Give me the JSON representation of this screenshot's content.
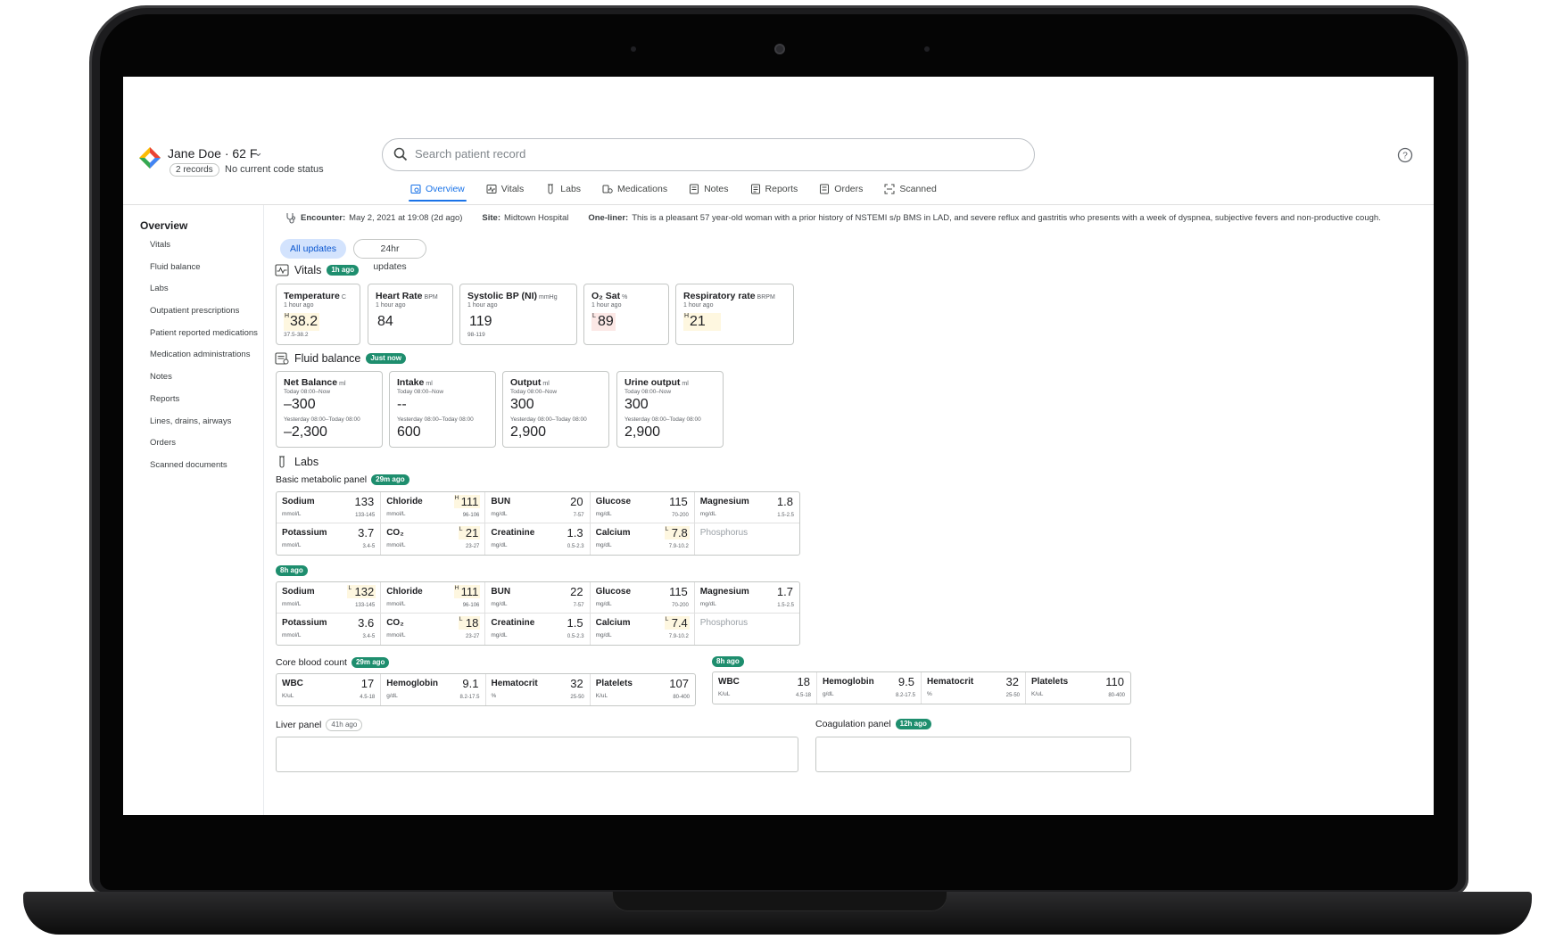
{
  "header": {
    "patient_name": "Jane Doe · 62 F",
    "records_chip": "2 records",
    "code_status": "No current code status",
    "search_placeholder": "Search patient record"
  },
  "tabs": [
    "Overview",
    "Vitals",
    "Labs",
    "Medications",
    "Notes",
    "Reports",
    "Orders",
    "Scanned"
  ],
  "sidebar": {
    "title": "Overview",
    "items": [
      "Vitals",
      "Fluid balance",
      "Labs",
      "Outpatient prescriptions",
      "Patient reported medications",
      "Medication administrations",
      "Notes",
      "Reports",
      "Lines, drains, airways",
      "Orders",
      "Scanned documents"
    ]
  },
  "encounter": {
    "encounter_label": "Encounter:",
    "encounter_value": "May 2, 2021 at 19:08 (2d ago)",
    "site_label": "Site:",
    "site_value": "Midtown Hospital",
    "oneliner_label": "One-liner:",
    "oneliner_value": "This is a pleasant 57 year-old woman with a prior history of NSTEMI s/p BMS in LAD, and severe reflux and gastritis who presents with a week of dyspnea, subjective fevers and non-productive cough."
  },
  "filters": {
    "all": "All updates",
    "day": "24hr updates"
  },
  "vitals": {
    "title": "Vitals",
    "badge": "1h ago",
    "cards": [
      {
        "name": "Temperature",
        "unit": "C",
        "time": "1 hour ago",
        "flag": "H",
        "value": "38.2",
        "range": "37.5-38.2",
        "state": "hl"
      },
      {
        "name": "Heart Rate",
        "unit": "BPM",
        "time": "1 hour ago",
        "flag": "",
        "value": "84",
        "range": "",
        "state": ""
      },
      {
        "name": "Systolic BP (NI)",
        "unit": "mmHg",
        "time": "1 hour ago",
        "flag": "",
        "value": "119",
        "range": "98-119",
        "state": ""
      },
      {
        "name": "O₂ Sat",
        "unit": "%",
        "time": "1 hour ago",
        "flag": "L",
        "value": "89",
        "range": "",
        "state": "lo"
      },
      {
        "name": "Respiratory rate",
        "unit": "BRPM",
        "time": "1 hour ago",
        "flag": "H",
        "value": "21",
        "range": "",
        "state": "hl"
      }
    ]
  },
  "fluid": {
    "title": "Fluid balance",
    "badge": "Just now",
    "cards": [
      {
        "name": "Net Balance",
        "unit": "ml",
        "time1": "Today 08:00–Now",
        "value1": "–300",
        "time2": "Yesterday 08:00–Today 08:00",
        "value2": "–2,300"
      },
      {
        "name": "Intake",
        "unit": "ml",
        "time1": "Today 08:00–Now",
        "value1": "--",
        "time2": "Yesterday 08:00–Today 08:00",
        "value2": "600"
      },
      {
        "name": "Output",
        "unit": "ml",
        "time1": "Today 08:00–Now",
        "value1": "300",
        "time2": "Yesterday 08:00–Today 08:00",
        "value2": "2,900"
      },
      {
        "name": "Urine output",
        "unit": "ml",
        "time1": "Today 08:00–Now",
        "value1": "300",
        "time2": "Yesterday 08:00–Today 08:00",
        "value2": "2,900"
      }
    ]
  },
  "labs": {
    "title": "Labs",
    "bmp_title": "Basic metabolic panel",
    "bmp_badge": "29m ago",
    "bmp": [
      {
        "name": "Sodium",
        "unit": "mmol/L",
        "value": "133",
        "range": "133-145",
        "flag": ""
      },
      {
        "name": "Chloride",
        "unit": "mmol/L",
        "value": "111",
        "range": "96-106",
        "flag": "H"
      },
      {
        "name": "BUN",
        "unit": "mg/dL",
        "value": "20",
        "range": "7-57",
        "flag": ""
      },
      {
        "name": "Glucose",
        "unit": "mg/dL",
        "value": "115",
        "range": "70-200",
        "flag": ""
      },
      {
        "name": "Magnesium",
        "unit": "mg/dL",
        "value": "1.8",
        "range": "1.5-2.5",
        "flag": ""
      },
      {
        "name": "Potassium",
        "unit": "mmol/L",
        "value": "3.7",
        "range": "3.4-5",
        "flag": ""
      },
      {
        "name": "CO₂",
        "unit": "mmol/L",
        "value": "21",
        "range": "23-27",
        "flag": "L"
      },
      {
        "name": "Creatinine",
        "unit": "mg/dL",
        "value": "1.3",
        "range": "0.5-2.3",
        "flag": ""
      },
      {
        "name": "Calcium",
        "unit": "mg/dL",
        "value": "7.8",
        "range": "7.9-10.2",
        "flag": "L"
      },
      {
        "name": "Phosphorus",
        "unit": "",
        "value": "",
        "range": "",
        "flag": ""
      }
    ],
    "bmp2_badge": "8h ago",
    "bmp2": [
      {
        "name": "Sodium",
        "unit": "mmol/L",
        "value": "132",
        "range": "133-145",
        "flag": "L"
      },
      {
        "name": "Chloride",
        "unit": "mmol/L",
        "value": "111",
        "range": "96-106",
        "flag": "H"
      },
      {
        "name": "BUN",
        "unit": "mg/dL",
        "value": "22",
        "range": "7-57",
        "flag": ""
      },
      {
        "name": "Glucose",
        "unit": "mg/dL",
        "value": "115",
        "range": "70-200",
        "flag": ""
      },
      {
        "name": "Magnesium",
        "unit": "mg/dL",
        "value": "1.7",
        "range": "1.5-2.5",
        "flag": ""
      },
      {
        "name": "Potassium",
        "unit": "mmol/L",
        "value": "3.6",
        "range": "3.4-5",
        "flag": ""
      },
      {
        "name": "CO₂",
        "unit": "mmol/L",
        "value": "18",
        "range": "23-27",
        "flag": "L"
      },
      {
        "name": "Creatinine",
        "unit": "mg/dL",
        "value": "1.5",
        "range": "0.5-2.3",
        "flag": ""
      },
      {
        "name": "Calcium",
        "unit": "mg/dL",
        "value": "7.4",
        "range": "7.9-10.2",
        "flag": "L"
      },
      {
        "name": "Phosphorus",
        "unit": "",
        "value": "",
        "range": "",
        "flag": ""
      }
    ],
    "cbc_title": "Core blood count",
    "cbc_badge": "29m ago",
    "cbc": [
      {
        "name": "WBC",
        "unit": "K/uL",
        "value": "17",
        "range": "4.5-18",
        "flag": ""
      },
      {
        "name": "Hemoglobin",
        "unit": "g/dL",
        "value": "9.1",
        "range": "8.2-17.5",
        "flag": ""
      },
      {
        "name": "Hematocrit",
        "unit": "%",
        "value": "32",
        "range": "25-50",
        "flag": ""
      },
      {
        "name": "Platelets",
        "unit": "K/uL",
        "value": "107",
        "range": "80-400",
        "flag": ""
      }
    ],
    "cbc2_badge": "8h ago",
    "cbc2": [
      {
        "name": "WBC",
        "unit": "K/uL",
        "value": "18",
        "range": "4.5-18",
        "flag": ""
      },
      {
        "name": "Hemoglobin",
        "unit": "g/dL",
        "value": "9.5",
        "range": "8.2-17.5",
        "flag": ""
      },
      {
        "name": "Hematocrit",
        "unit": "%",
        "value": "32",
        "range": "25-50",
        "flag": ""
      },
      {
        "name": "Platelets",
        "unit": "K/uL",
        "value": "110",
        "range": "80-400",
        "flag": ""
      }
    ],
    "liver_title": "Liver panel",
    "liver_badge": "41h ago",
    "coag_title": "Coagulation panel",
    "coag_badge": "12h ago"
  }
}
